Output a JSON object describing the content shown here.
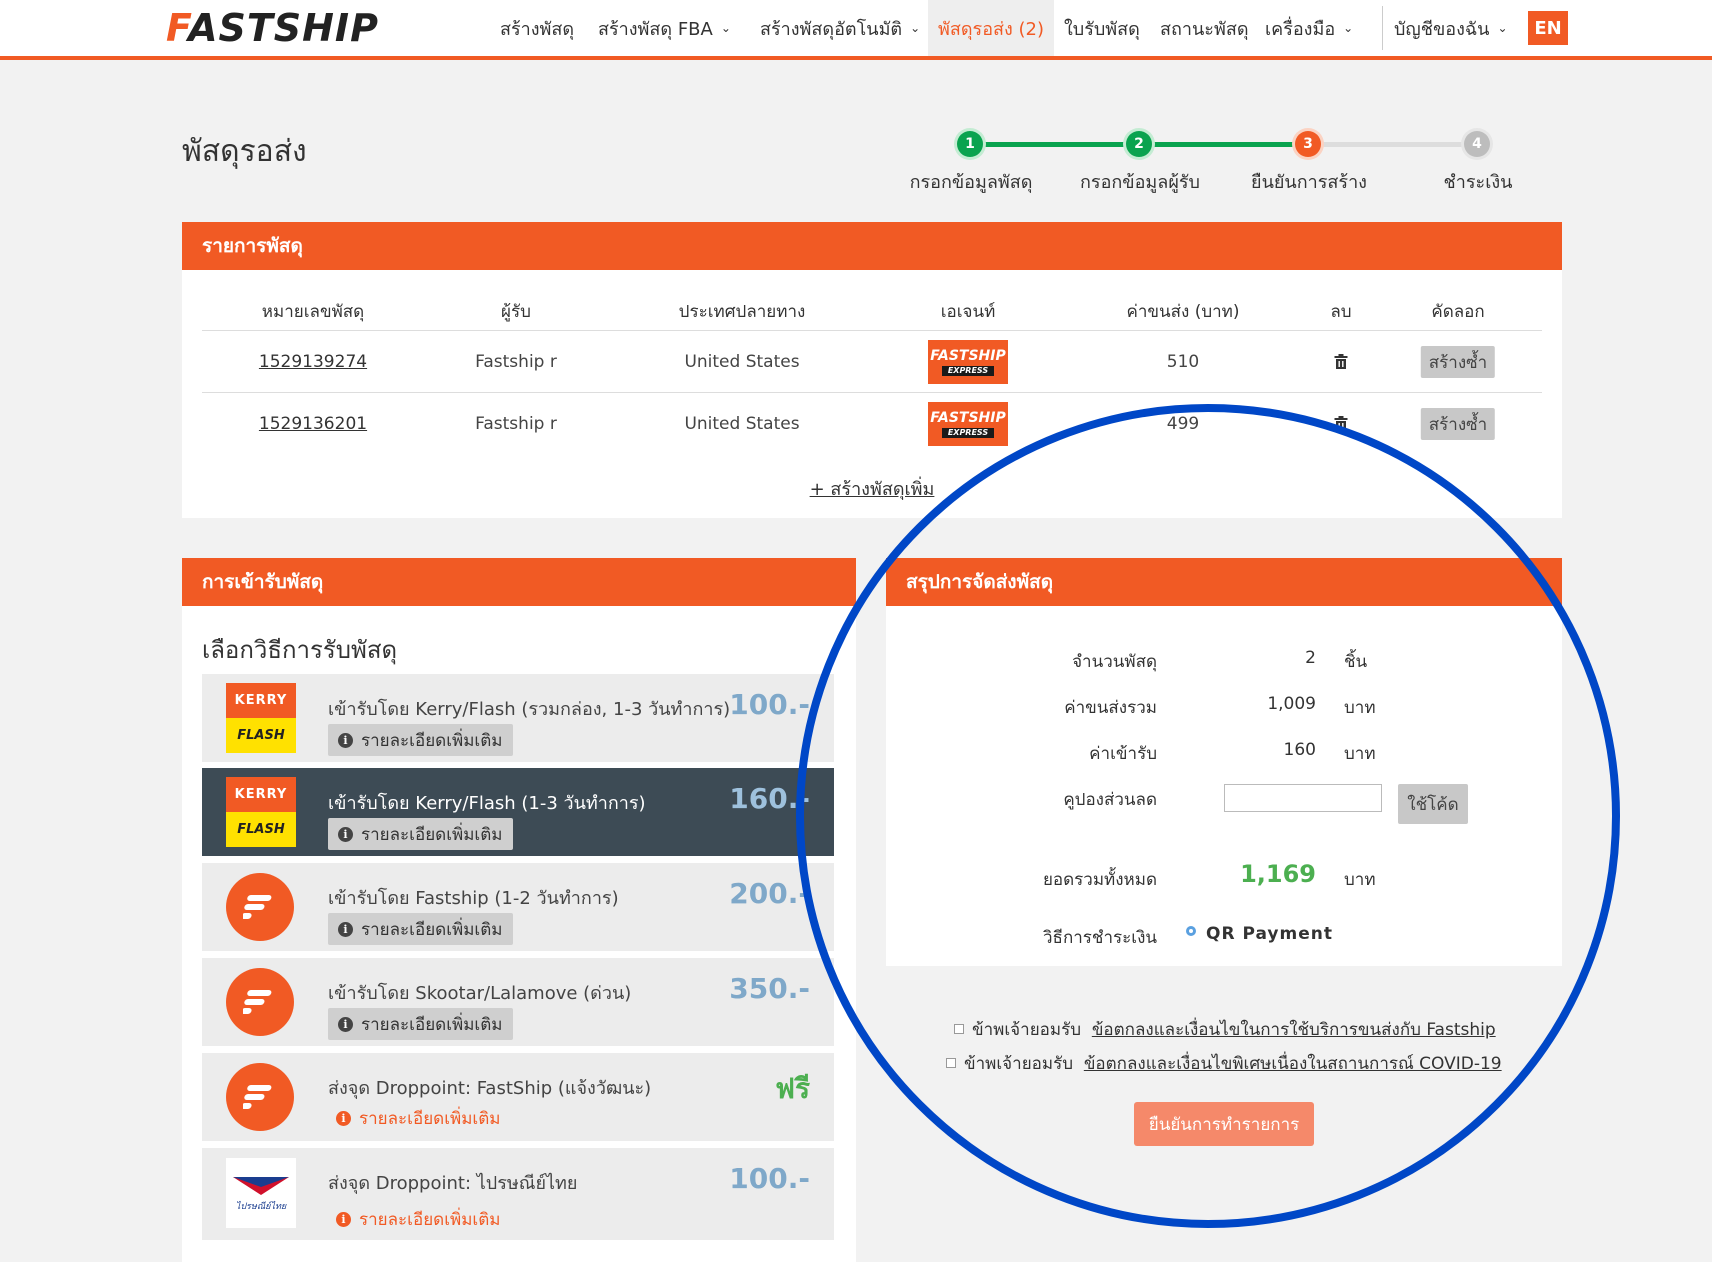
{
  "header": {
    "logo_f": "F",
    "logo_rest": "ASTSHIP",
    "nav": [
      {
        "label": "สร้างพัสดุ",
        "chevron": false
      },
      {
        "label": "สร้างพัสดุ FBA",
        "chevron": true
      },
      {
        "label": "สร้างพัสดุอัตโนมัติ",
        "chevron": true
      },
      {
        "label": "พัสดุรอส่ง (2)",
        "chevron": false,
        "active": true
      },
      {
        "label": "ใบรับพัสดุ",
        "chevron": false
      },
      {
        "label": "สถานะพัสดุ",
        "chevron": false
      },
      {
        "label": "เครื่องมือ",
        "chevron": true
      }
    ],
    "account": "บัญชีของฉัน",
    "lang": "EN",
    "accent_color": "#f15a24"
  },
  "page": {
    "title": "พัสดุรอส่ง"
  },
  "stepper": [
    {
      "num": "1",
      "label": "กรอกข้อมูลพัสดุ",
      "state": "done"
    },
    {
      "num": "2",
      "label": "กรอกข้อมูลผู้รับ",
      "state": "done"
    },
    {
      "num": "3",
      "label": "ยืนยันการสร้าง",
      "state": "current"
    },
    {
      "num": "4",
      "label": "ชำระเงิน",
      "state": "todo"
    }
  ],
  "parcel_list": {
    "heading": "รายการพัสดุ",
    "columns": [
      "หมายเลขพัสดุ",
      "ผู้รับ",
      "ประเทศปลายทาง",
      "เอเจนท์",
      "ค่าขนส่ง (บาท)",
      "ลบ",
      "คัดลอก"
    ],
    "rows": [
      {
        "id": "1529139274",
        "recipient": "Fastship r",
        "country": "United States",
        "agent": "FASTSHIP",
        "agent_sub": "EXPRESS",
        "cost": "510",
        "copy": "สร้างซ้ำ"
      },
      {
        "id": "1529136201",
        "recipient": "Fastship r",
        "country": "United States",
        "agent": "FASTSHIP",
        "agent_sub": "EXPRESS",
        "cost": "499",
        "copy": "สร้างซ้ำ"
      }
    ],
    "add_link": "+ สร้างพัสดุเพิ่ม"
  },
  "pickup": {
    "heading": "การเข้ารับพัสดุ",
    "subtitle": "เลือกวิธีการรับพัสดุ",
    "options": [
      {
        "logo": "kerry-flash",
        "title": "เข้ารับโดย Kerry/Flash (รวมกล่อง, 1-3 วันทำการ)",
        "price": "100.-",
        "detail": "รายละเอียดเพิ่มเติม",
        "selected": false
      },
      {
        "logo": "kerry-flash",
        "title": "เข้ารับโดย Kerry/Flash (1-3 วันทำการ)",
        "price": "160.-",
        "detail": "รายละเอียดเพิ่มเติม",
        "selected": true
      },
      {
        "logo": "fastship",
        "title": "เข้ารับโดย Fastship (1-2 วันทำการ)",
        "price": "200.-",
        "detail": "รายละเอียดเพิ่มเติม",
        "selected": false
      },
      {
        "logo": "fastship",
        "title": "เข้ารับโดย Skootar/Lalamove (ด่วน)",
        "price": "350.-",
        "detail": "รายละเอียดเพิ่มเติม",
        "selected": false
      },
      {
        "logo": "fastship",
        "title": "ส่งจุด Droppoint: FastShip (แจ้งวัฒนะ)",
        "price": "ฟรี",
        "detail": "รายละเอียดเพิ่มเติม",
        "selected": false
      },
      {
        "logo": "thai-post",
        "title": "ส่งจุด Droppoint: ไปรษณีย์ไทย",
        "price": "100.-",
        "detail": "รายละเอียดเพิ่มเติม",
        "selected": false
      }
    ],
    "kerry_text": "KERRY",
    "flash_text": "FLASH",
    "thaipost_text": "ไปรษณีย์ไทย"
  },
  "summary": {
    "heading": "สรุปการจัดส่งพัสดุ",
    "count_label": "จำนวนพัสดุ",
    "count_value": "2",
    "count_unit": "ชิ้น",
    "shipping_label": "ค่าขนส่งรวม",
    "shipping_value": "1,009",
    "shipping_unit": "บาท",
    "pickup_label": "ค่าเข้ารับ",
    "pickup_value": "160",
    "pickup_unit": "บาท",
    "coupon_label": "คูปองส่วนลด",
    "coupon_value": "",
    "coupon_button": "ใช้โค้ด",
    "total_label": "ยอดรวมทั้งหมด",
    "total_value": "1,169",
    "total_unit": "บาท",
    "payment_label": "วิธีการชำระเงิน",
    "payment_value": "QR Payment"
  },
  "terms": [
    {
      "prefix": "ข้าพเจ้ายอมรับ",
      "link": "ข้อตกลงและเงื่อนไขในการใช้บริการขนส่งกับ Fastship",
      "checked": false
    },
    {
      "prefix": "ข้าพเจ้ายอมรับ",
      "link": "ข้อตกลงและเงื่อนไขพิเศษเนื่องในสถานการณ์ COVID-19",
      "checked": false
    }
  ],
  "confirm_button": "ยืนยันการทำรายการ",
  "highlight_color": "#0047c7"
}
